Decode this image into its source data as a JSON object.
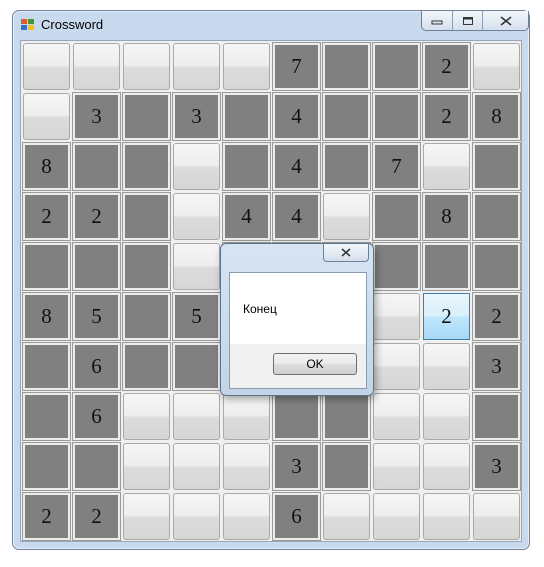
{
  "window": {
    "title": "Crossword"
  },
  "grid": {
    "rows": [
      [
        {
          "t": "light",
          "v": ""
        },
        {
          "t": "light",
          "v": ""
        },
        {
          "t": "light",
          "v": ""
        },
        {
          "t": "light",
          "v": ""
        },
        {
          "t": "light",
          "v": ""
        },
        {
          "t": "dark",
          "v": "7"
        },
        {
          "t": "dark",
          "v": ""
        },
        {
          "t": "dark",
          "v": ""
        },
        {
          "t": "dark",
          "v": "2"
        },
        {
          "t": "light",
          "v": ""
        }
      ],
      [
        {
          "t": "light",
          "v": ""
        },
        {
          "t": "dark",
          "v": "3"
        },
        {
          "t": "dark",
          "v": ""
        },
        {
          "t": "dark",
          "v": "3"
        },
        {
          "t": "dark",
          "v": ""
        },
        {
          "t": "dark",
          "v": "4"
        },
        {
          "t": "dark",
          "v": ""
        },
        {
          "t": "dark",
          "v": ""
        },
        {
          "t": "dark",
          "v": "2"
        },
        {
          "t": "dark",
          "v": "8"
        }
      ],
      [
        {
          "t": "dark",
          "v": "8"
        },
        {
          "t": "dark",
          "v": ""
        },
        {
          "t": "dark",
          "v": ""
        },
        {
          "t": "light",
          "v": ""
        },
        {
          "t": "dark",
          "v": ""
        },
        {
          "t": "dark",
          "v": "4"
        },
        {
          "t": "dark",
          "v": ""
        },
        {
          "t": "dark",
          "v": "7"
        },
        {
          "t": "light",
          "v": ""
        },
        {
          "t": "dark",
          "v": ""
        }
      ],
      [
        {
          "t": "dark",
          "v": "2"
        },
        {
          "t": "dark",
          "v": "2"
        },
        {
          "t": "dark",
          "v": ""
        },
        {
          "t": "light",
          "v": ""
        },
        {
          "t": "dark",
          "v": "4"
        },
        {
          "t": "dark",
          "v": "4"
        },
        {
          "t": "light",
          "v": ""
        },
        {
          "t": "dark",
          "v": ""
        },
        {
          "t": "dark",
          "v": "8"
        },
        {
          "t": "dark",
          "v": ""
        }
      ],
      [
        {
          "t": "dark",
          "v": ""
        },
        {
          "t": "dark",
          "v": ""
        },
        {
          "t": "dark",
          "v": ""
        },
        {
          "t": "light",
          "v": ""
        },
        {
          "t": "dark",
          "v": ""
        },
        {
          "t": "dark",
          "v": ""
        },
        {
          "t": "dark",
          "v": ""
        },
        {
          "t": "dark",
          "v": ""
        },
        {
          "t": "dark",
          "v": ""
        },
        {
          "t": "dark",
          "v": ""
        }
      ],
      [
        {
          "t": "dark",
          "v": "8"
        },
        {
          "t": "dark",
          "v": "5"
        },
        {
          "t": "dark",
          "v": ""
        },
        {
          "t": "dark",
          "v": "5"
        },
        {
          "t": "dark",
          "v": ""
        },
        {
          "t": "dark",
          "v": ""
        },
        {
          "t": "dark",
          "v": ""
        },
        {
          "t": "light",
          "v": ""
        },
        {
          "t": "focus",
          "v": "2"
        },
        {
          "t": "dark",
          "v": "2"
        }
      ],
      [
        {
          "t": "dark",
          "v": ""
        },
        {
          "t": "dark",
          "v": "6"
        },
        {
          "t": "dark",
          "v": ""
        },
        {
          "t": "dark",
          "v": ""
        },
        {
          "t": "dark",
          "v": ""
        },
        {
          "t": "dark",
          "v": ""
        },
        {
          "t": "dark",
          "v": ""
        },
        {
          "t": "light",
          "v": ""
        },
        {
          "t": "light",
          "v": ""
        },
        {
          "t": "dark",
          "v": "3"
        }
      ],
      [
        {
          "t": "dark",
          "v": ""
        },
        {
          "t": "dark",
          "v": "6"
        },
        {
          "t": "light",
          "v": ""
        },
        {
          "t": "light",
          "v": ""
        },
        {
          "t": "light",
          "v": ""
        },
        {
          "t": "dark",
          "v": ""
        },
        {
          "t": "dark",
          "v": ""
        },
        {
          "t": "light",
          "v": ""
        },
        {
          "t": "light",
          "v": ""
        },
        {
          "t": "dark",
          "v": ""
        }
      ],
      [
        {
          "t": "dark",
          "v": ""
        },
        {
          "t": "dark",
          "v": ""
        },
        {
          "t": "light",
          "v": ""
        },
        {
          "t": "light",
          "v": ""
        },
        {
          "t": "light",
          "v": ""
        },
        {
          "t": "dark",
          "v": "3"
        },
        {
          "t": "dark",
          "v": ""
        },
        {
          "t": "light",
          "v": ""
        },
        {
          "t": "light",
          "v": ""
        },
        {
          "t": "dark",
          "v": "3"
        }
      ],
      [
        {
          "t": "dark",
          "v": "2"
        },
        {
          "t": "dark",
          "v": "2"
        },
        {
          "t": "light",
          "v": ""
        },
        {
          "t": "light",
          "v": ""
        },
        {
          "t": "light",
          "v": ""
        },
        {
          "t": "dark",
          "v": "6"
        },
        {
          "t": "light",
          "v": ""
        },
        {
          "t": "light",
          "v": ""
        },
        {
          "t": "light",
          "v": ""
        },
        {
          "t": "light",
          "v": ""
        }
      ]
    ]
  },
  "dialog": {
    "message": "Конец",
    "ok_label": "OK"
  },
  "icons": {
    "app": "crossword-app-icon",
    "minimize": "minimize-icon",
    "maximize": "maximize-icon",
    "close": "close-icon"
  },
  "colors": {
    "dark_cell": "#808080",
    "light_cell": "#e6e6e6",
    "focus_border": "#3c7fb1",
    "frame": "#c9daee"
  }
}
